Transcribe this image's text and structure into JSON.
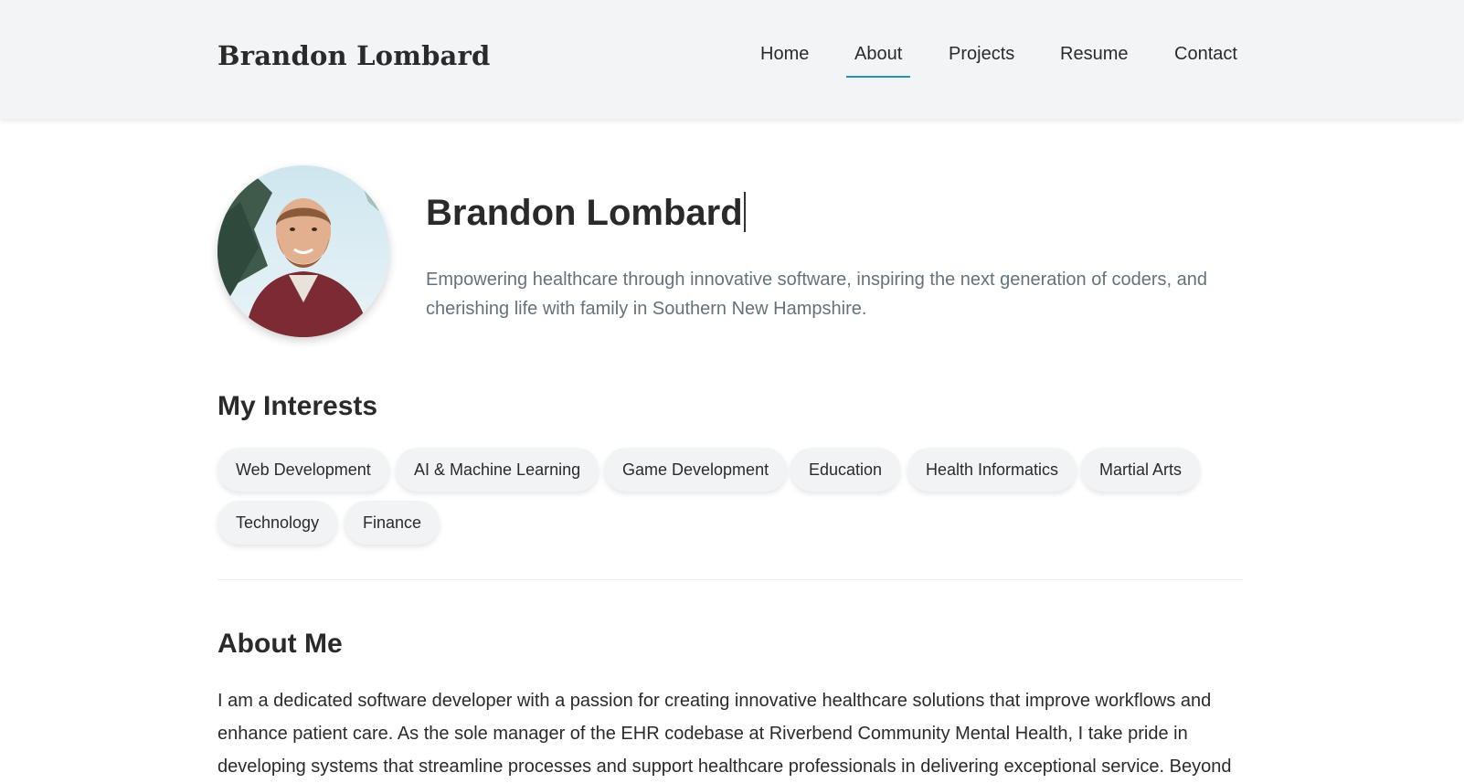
{
  "header": {
    "brand": "Brandon Lombard",
    "nav": [
      {
        "label": "Home",
        "active": false
      },
      {
        "label": "About",
        "active": true
      },
      {
        "label": "Projects",
        "active": false
      },
      {
        "label": "Resume",
        "active": false
      },
      {
        "label": "Contact",
        "active": false
      }
    ],
    "accent_color": "#2a8fb4"
  },
  "hero": {
    "name": "Brandon Lombard",
    "tagline": "Empowering healthcare through innovative software, inspiring the next generation of coders, and cherishing life with family in Southern New Hampshire."
  },
  "interests": {
    "title": "My Interests",
    "items": [
      "Web Development",
      "AI & Machine Learning",
      "Game Development",
      "Education",
      "Health Informatics",
      "Martial Arts",
      "Technology",
      "Finance"
    ]
  },
  "about": {
    "title": "About Me",
    "text": "I am a dedicated software developer with a passion for creating innovative healthcare solutions that improve workflows and enhance patient care. As the sole manager of the EHR codebase at Riverbend Community Mental Health, I take pride in developing systems that streamline processes and support healthcare professionals in delivering exceptional service. Beyond"
  }
}
